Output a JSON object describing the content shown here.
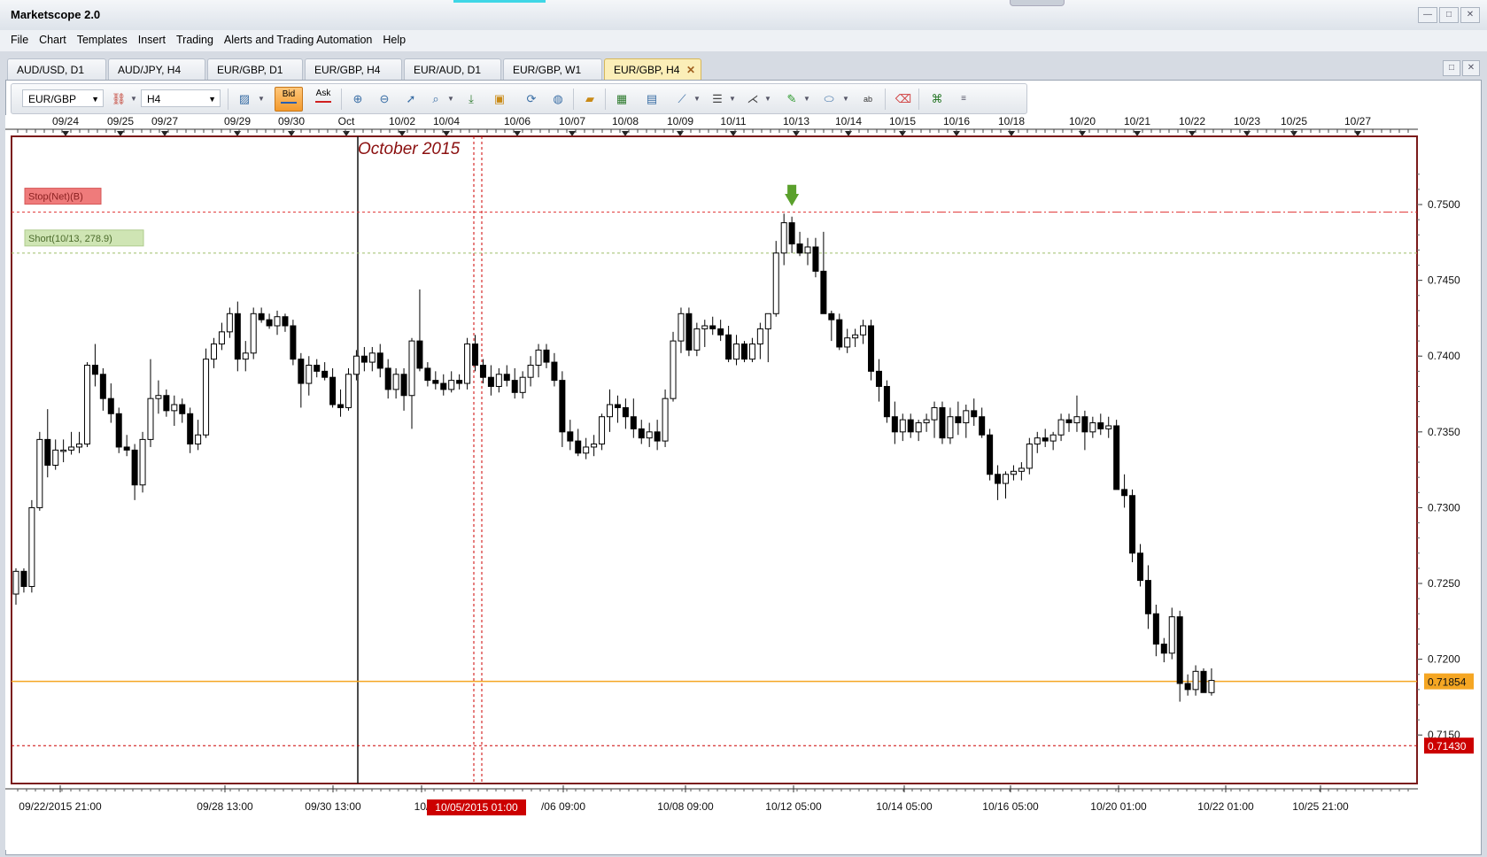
{
  "app": {
    "title": "Marketscope 2.0"
  },
  "window_controls": {
    "minimize": "—",
    "maximize": "□",
    "close": "✕"
  },
  "menu": [
    "File",
    "Chart",
    "Templates",
    "Insert",
    "Trading",
    "Alerts and Trading Automation",
    "Help"
  ],
  "tabs": [
    {
      "label": "AUD/USD, D1"
    },
    {
      "label": "AUD/JPY, H4"
    },
    {
      "label": "EUR/GBP, D1"
    },
    {
      "label": "EUR/GBP, H4"
    },
    {
      "label": "EUR/AUD, D1"
    },
    {
      "label": "EUR/GBP, W1"
    },
    {
      "label": "EUR/GBP, H4",
      "active": true,
      "close": "✕"
    }
  ],
  "toolbar": {
    "symbol": "EUR/GBP",
    "timeframe": "H4",
    "bid_label": "Bid",
    "ask_label": "Ask",
    "icons": [
      "indicator-icon",
      "zoom-in-icon",
      "zoom-out-icon",
      "cursor-icon",
      "zoom-icon",
      "scroll-end-icon",
      "screenshot-icon",
      "sync-icon",
      "globe-icon",
      "ruler-icon",
      "image-icon",
      "template-icon",
      "line-tool-icon",
      "levels-icon",
      "fan-icon",
      "pencil-icon",
      "ellipse-icon",
      "text-icon",
      "eraser-icon",
      "tree-icon",
      "more-icon"
    ]
  },
  "colors": {
    "bull": "#ffffff",
    "bear": "#000000",
    "frame_border": "#7a1a1a",
    "current_price_line": "#f5a623",
    "stop_line": "#e03030",
    "short_line": "#9dbf6a",
    "date_marker": "#cc0000"
  },
  "chart_data": {
    "type": "candlestick",
    "symbol": "EUR/GBP",
    "timeframe": "H4",
    "period_label": "October 2015",
    "y_ticks": [
      "0.7500",
      "0.7450",
      "0.7400",
      "0.7350",
      "0.7300",
      "0.7250",
      "0.7200",
      "0.7150"
    ],
    "y_min": 0.7118,
    "y_max": 0.7545,
    "top_date_labels": [
      "09/24",
      "09/25",
      "09/27",
      "09/29",
      "09/30",
      "Oct",
      "10/02",
      "10/04",
      "10/06",
      "10/07",
      "10/08",
      "10/09",
      "10/11",
      "10/13",
      "10/14",
      "10/15",
      "10/16",
      "10/18",
      "10/20",
      "10/21",
      "10/22",
      "10/23",
      "10/25",
      "10/27"
    ],
    "bottom_time_labels": [
      "09/22/2015 21:00",
      "09/28 13:00",
      "09/30 13:00",
      "10/",
      "/06 09:00",
      "10/08 09:00",
      "10/12 05:00",
      "10/14 05:00",
      "10/16 05:00",
      "10/20 01:00",
      "10/22 01:00",
      "10/25 21:00"
    ],
    "highlighted_time": "10/05/2015 01:00",
    "current_price": "0.71854",
    "marker_price": "0.71430",
    "stop_order": {
      "label": "Stop(Net)(B)",
      "price": 0.7495
    },
    "short_position": {
      "label": "Short(10/13, 278.9)",
      "price": 0.7468
    },
    "candles": [
      [
        0.7243,
        0.726,
        0.7236,
        0.7258
      ],
      [
        0.7258,
        0.726,
        0.7244,
        0.7248
      ],
      [
        0.7248,
        0.7305,
        0.7244,
        0.73
      ],
      [
        0.73,
        0.735,
        0.7298,
        0.7345
      ],
      [
        0.7345,
        0.7365,
        0.732,
        0.7328
      ],
      [
        0.7328,
        0.7345,
        0.7325,
        0.7338
      ],
      [
        0.7338,
        0.7345,
        0.733,
        0.7338
      ],
      [
        0.7338,
        0.735,
        0.7335,
        0.734
      ],
      [
        0.734,
        0.735,
        0.7336,
        0.7342
      ],
      [
        0.7342,
        0.7396,
        0.734,
        0.7394
      ],
      [
        0.7394,
        0.7408,
        0.738,
        0.7388
      ],
      [
        0.7388,
        0.7392,
        0.7364,
        0.7372
      ],
      [
        0.7372,
        0.7382,
        0.7356,
        0.7362
      ],
      [
        0.7362,
        0.7366,
        0.7336,
        0.734
      ],
      [
        0.734,
        0.7348,
        0.7334,
        0.7338
      ],
      [
        0.7338,
        0.7342,
        0.7305,
        0.7315
      ],
      [
        0.7315,
        0.735,
        0.731,
        0.7345
      ],
      [
        0.7345,
        0.7398,
        0.734,
        0.7372
      ],
      [
        0.7372,
        0.7384,
        0.7362,
        0.7374
      ],
      [
        0.7374,
        0.7378,
        0.736,
        0.7364
      ],
      [
        0.7364,
        0.7374,
        0.7354,
        0.7368
      ],
      [
        0.7368,
        0.7372,
        0.7356,
        0.7362
      ],
      [
        0.7362,
        0.7366,
        0.7336,
        0.7342
      ],
      [
        0.7342,
        0.7358,
        0.7338,
        0.7348
      ],
      [
        0.7348,
        0.7405,
        0.7346,
        0.7398
      ],
      [
        0.7398,
        0.7412,
        0.7392,
        0.7408
      ],
      [
        0.7408,
        0.7422,
        0.7404,
        0.7416
      ],
      [
        0.7416,
        0.7432,
        0.7412,
        0.7428
      ],
      [
        0.7428,
        0.7436,
        0.739,
        0.7398
      ],
      [
        0.7398,
        0.741,
        0.739,
        0.7402
      ],
      [
        0.7402,
        0.7432,
        0.7398,
        0.7428
      ],
      [
        0.7428,
        0.7432,
        0.7422,
        0.7424
      ],
      [
        0.7424,
        0.7428,
        0.7418,
        0.742
      ],
      [
        0.742,
        0.743,
        0.7414,
        0.7426
      ],
      [
        0.7426,
        0.7428,
        0.7416,
        0.742
      ],
      [
        0.742,
        0.7424,
        0.7394,
        0.7398
      ],
      [
        0.7398,
        0.7402,
        0.7366,
        0.7382
      ],
      [
        0.7382,
        0.74,
        0.7374,
        0.7394
      ],
      [
        0.7394,
        0.7398,
        0.7386,
        0.739
      ],
      [
        0.739,
        0.7396,
        0.7384,
        0.7386
      ],
      [
        0.7386,
        0.7392,
        0.7366,
        0.7368
      ],
      [
        0.7368,
        0.7378,
        0.736,
        0.7366
      ],
      [
        0.7366,
        0.7392,
        0.7364,
        0.7388
      ],
      [
        0.7388,
        0.7404,
        0.7384,
        0.74
      ],
      [
        0.74,
        0.7406,
        0.739,
        0.7396
      ],
      [
        0.7396,
        0.7406,
        0.739,
        0.7402
      ],
      [
        0.7402,
        0.7408,
        0.7386,
        0.7392
      ],
      [
        0.7392,
        0.7398,
        0.7372,
        0.7378
      ],
      [
        0.7378,
        0.7392,
        0.7372,
        0.7388
      ],
      [
        0.7388,
        0.7392,
        0.7364,
        0.7374
      ],
      [
        0.7374,
        0.7412,
        0.7352,
        0.741
      ],
      [
        0.741,
        0.7444,
        0.739,
        0.7392
      ],
      [
        0.7392,
        0.7396,
        0.738,
        0.7384
      ],
      [
        0.7384,
        0.739,
        0.7378,
        0.7382
      ],
      [
        0.7382,
        0.7388,
        0.7374,
        0.7378
      ],
      [
        0.7378,
        0.739,
        0.7376,
        0.7384
      ],
      [
        0.7384,
        0.7388,
        0.7378,
        0.7382
      ],
      [
        0.7382,
        0.7412,
        0.7378,
        0.7408
      ],
      [
        0.7408,
        0.7414,
        0.739,
        0.7394
      ],
      [
        0.7394,
        0.7398,
        0.7382,
        0.7386
      ],
      [
        0.7386,
        0.7394,
        0.7374,
        0.738
      ],
      [
        0.738,
        0.7392,
        0.7376,
        0.7388
      ],
      [
        0.7388,
        0.7394,
        0.738,
        0.7384
      ],
      [
        0.7384,
        0.7392,
        0.7372,
        0.7376
      ],
      [
        0.7376,
        0.739,
        0.7372,
        0.7386
      ],
      [
        0.7386,
        0.74,
        0.738,
        0.7394
      ],
      [
        0.7394,
        0.7408,
        0.7386,
        0.7404
      ],
      [
        0.7404,
        0.7408,
        0.7392,
        0.7396
      ],
      [
        0.7396,
        0.7402,
        0.738,
        0.7384
      ],
      [
        0.7384,
        0.739,
        0.734,
        0.735
      ],
      [
        0.735,
        0.7358,
        0.7338,
        0.7344
      ],
      [
        0.7344,
        0.7352,
        0.7334,
        0.7336
      ],
      [
        0.7336,
        0.7346,
        0.7332,
        0.734
      ],
      [
        0.734,
        0.7348,
        0.7334,
        0.7342
      ],
      [
        0.7342,
        0.7362,
        0.7338,
        0.736
      ],
      [
        0.736,
        0.7378,
        0.735,
        0.7368
      ],
      [
        0.7368,
        0.7374,
        0.7356,
        0.7366
      ],
      [
        0.7366,
        0.7372,
        0.7352,
        0.736
      ],
      [
        0.736,
        0.7372,
        0.7346,
        0.7352
      ],
      [
        0.7352,
        0.7358,
        0.7342,
        0.7346
      ],
      [
        0.7346,
        0.7356,
        0.734,
        0.735
      ],
      [
        0.735,
        0.7358,
        0.7338,
        0.7344
      ],
      [
        0.7344,
        0.7378,
        0.734,
        0.7372
      ],
      [
        0.7372,
        0.7416,
        0.737,
        0.741
      ],
      [
        0.741,
        0.7432,
        0.7402,
        0.7428
      ],
      [
        0.7428,
        0.7432,
        0.74,
        0.7404
      ],
      [
        0.7404,
        0.7422,
        0.74,
        0.7418
      ],
      [
        0.7418,
        0.7424,
        0.7406,
        0.742
      ],
      [
        0.742,
        0.7426,
        0.7414,
        0.7418
      ],
      [
        0.7418,
        0.7424,
        0.741,
        0.7414
      ],
      [
        0.7414,
        0.742,
        0.7396,
        0.7398
      ],
      [
        0.7398,
        0.7414,
        0.7394,
        0.7408
      ],
      [
        0.7408,
        0.741,
        0.7396,
        0.7398
      ],
      [
        0.7398,
        0.7412,
        0.7396,
        0.7408
      ],
      [
        0.7408,
        0.7422,
        0.7398,
        0.7418
      ],
      [
        0.7418,
        0.7428,
        0.7396,
        0.7428
      ],
      [
        0.7428,
        0.7476,
        0.7426,
        0.7468
      ],
      [
        0.7468,
        0.7494,
        0.746,
        0.7488
      ],
      [
        0.7488,
        0.7492,
        0.7468,
        0.7474
      ],
      [
        0.7474,
        0.7482,
        0.7466,
        0.7468
      ],
      [
        0.7468,
        0.7478,
        0.746,
        0.7472
      ],
      [
        0.7472,
        0.7478,
        0.7452,
        0.7456
      ],
      [
        0.7456,
        0.7482,
        0.7446,
        0.7428
      ],
      [
        0.7428,
        0.743,
        0.741,
        0.7424
      ],
      [
        0.7424,
        0.7428,
        0.7404,
        0.7406
      ],
      [
        0.7406,
        0.7418,
        0.7402,
        0.7412
      ],
      [
        0.7412,
        0.7418,
        0.7406,
        0.7414
      ],
      [
        0.7414,
        0.7424,
        0.7408,
        0.742
      ],
      [
        0.742,
        0.7424,
        0.7384,
        0.739
      ],
      [
        0.739,
        0.7398,
        0.737,
        0.738
      ],
      [
        0.738,
        0.7384,
        0.7356,
        0.736
      ],
      [
        0.736,
        0.737,
        0.7342,
        0.735
      ],
      [
        0.735,
        0.7362,
        0.7344,
        0.7358
      ],
      [
        0.7358,
        0.7362,
        0.7346,
        0.735
      ],
      [
        0.735,
        0.7358,
        0.7344,
        0.7356
      ],
      [
        0.7356,
        0.7362,
        0.735,
        0.7358
      ],
      [
        0.7358,
        0.737,
        0.7346,
        0.7366
      ],
      [
        0.7366,
        0.737,
        0.7342,
        0.7346
      ],
      [
        0.7346,
        0.7366,
        0.7342,
        0.736
      ],
      [
        0.736,
        0.737,
        0.7348,
        0.7356
      ],
      [
        0.7356,
        0.7368,
        0.7346,
        0.7364
      ],
      [
        0.7364,
        0.7372,
        0.7354,
        0.736
      ],
      [
        0.736,
        0.7366,
        0.7346,
        0.7348
      ],
      [
        0.7348,
        0.7352,
        0.7318,
        0.7322
      ],
      [
        0.7322,
        0.7328,
        0.7305,
        0.7316
      ],
      [
        0.7316,
        0.7324,
        0.7306,
        0.7322
      ],
      [
        0.7322,
        0.7328,
        0.7318,
        0.7324
      ],
      [
        0.7324,
        0.733,
        0.7318,
        0.7326
      ],
      [
        0.7326,
        0.7346,
        0.7322,
        0.7342
      ],
      [
        0.7342,
        0.735,
        0.7336,
        0.7346
      ],
      [
        0.7346,
        0.7352,
        0.734,
        0.7344
      ],
      [
        0.7344,
        0.735,
        0.7338,
        0.7348
      ],
      [
        0.7348,
        0.7362,
        0.7344,
        0.7358
      ],
      [
        0.7358,
        0.7362,
        0.735,
        0.7356
      ],
      [
        0.7356,
        0.7374,
        0.735,
        0.736
      ],
      [
        0.736,
        0.7364,
        0.7338,
        0.735
      ],
      [
        0.735,
        0.736,
        0.7346,
        0.7356
      ],
      [
        0.7356,
        0.7362,
        0.7348,
        0.7352
      ],
      [
        0.7352,
        0.736,
        0.7346,
        0.7354
      ],
      [
        0.7354,
        0.7358,
        0.734,
        0.7312
      ],
      [
        0.7312,
        0.7322,
        0.73,
        0.7308
      ],
      [
        0.7308,
        0.7312,
        0.7264,
        0.727
      ],
      [
        0.727,
        0.7276,
        0.7248,
        0.7252
      ],
      [
        0.7252,
        0.7262,
        0.722,
        0.723
      ],
      [
        0.723,
        0.7236,
        0.7202,
        0.721
      ],
      [
        0.721,
        0.7214,
        0.7198,
        0.7204
      ],
      [
        0.7204,
        0.7234,
        0.72,
        0.7228
      ],
      [
        0.7228,
        0.7232,
        0.7172,
        0.7184
      ],
      [
        0.7184,
        0.719,
        0.7176,
        0.718
      ],
      [
        0.718,
        0.7196,
        0.7176,
        0.7192
      ],
      [
        0.7192,
        0.7194,
        0.7178,
        0.7178
      ],
      [
        0.7178,
        0.7194,
        0.7176,
        0.7186
      ]
    ]
  }
}
